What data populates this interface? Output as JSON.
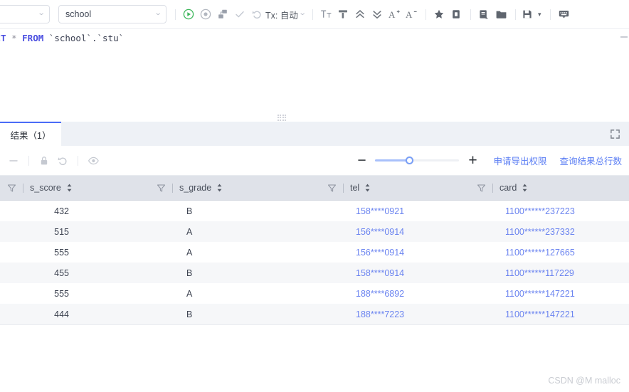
{
  "toolbar": {
    "connection_select": {
      "value": "",
      "caret": "chevron-down-icon"
    },
    "database_select": {
      "value": "school",
      "caret": "chevron-down-icon"
    },
    "run_label": "run-icon",
    "run_selection_label": "run-selection-icon",
    "explain_label": "execution-plan-icon",
    "check_label": "check-icon",
    "rollback_label": "undo-icon",
    "tx_label": "Tx: 自动",
    "format_label": "Tt",
    "beautify_label": "format-sql-icon",
    "collapse_all_label": "collapse-all-icon",
    "expand_all_label": "expand-all-icon",
    "font_increase_label": "A",
    "font_increase_sup": "+",
    "font_decrease_label": "A",
    "font_decrease_sup": "-",
    "favorite_label": "star-icon",
    "copy_label": "copy-icon",
    "snippet_label": "snippet-icon",
    "folder_label": "folder-icon",
    "save_label": "save-icon",
    "save_caret": "▾",
    "keyboard_label": "keyboard-icon"
  },
  "editor": {
    "sql_fragment_keyword1": "ECT",
    "sql_fragment_star": " * ",
    "sql_fragment_keyword2": "FROM",
    "sql_fragment_tables": " `school`.`stu`"
  },
  "results": {
    "tab_label": "结果（1）",
    "expand_icon": "fullscreen-icon",
    "toolbar": {
      "remove_row_icon": "minus-icon",
      "lock_icon": "lock-icon",
      "refresh_icon": "undo-icon",
      "view_icon": "eye-icon",
      "zoom_out": "−",
      "zoom_in": "+",
      "zoom_value": 40,
      "export_permission_link": "申请导出权限",
      "total_rows_link": "查询结果总行数"
    },
    "columns": [
      {
        "name": "s_score",
        "filter_icon": "filter-funnel-icon",
        "sort_icon": "sort-arrows-icon"
      },
      {
        "name": "s_grade",
        "filter_icon": "filter-funnel-icon",
        "sort_icon": "sort-arrows-icon"
      },
      {
        "name": "tel",
        "filter_icon": "filter-funnel-icon",
        "sort_icon": "sort-arrows-icon"
      },
      {
        "name": "card",
        "filter_icon": "filter-funnel-icon",
        "sort_icon": "sort-arrows-icon"
      }
    ],
    "rows": [
      {
        "s_score": "432",
        "s_grade": "B",
        "tel": "158****0921",
        "card": "1100******237223"
      },
      {
        "s_score": "515",
        "s_grade": "A",
        "tel": "156****0914",
        "card": "1100******237332"
      },
      {
        "s_score": "555",
        "s_grade": "A",
        "tel": "156****0914",
        "card": "1100******127665"
      },
      {
        "s_score": "455",
        "s_grade": "B",
        "tel": "158****0914",
        "card": "1100******117229"
      },
      {
        "s_score": "555",
        "s_grade": "A",
        "tel": "188****6892",
        "card": "1100******147221"
      },
      {
        "s_score": "444",
        "s_grade": "B",
        "tel": "188****7223",
        "card": "1100******147221"
      }
    ]
  },
  "watermark": {
    "text": "CSDN @M malloc"
  },
  "colors": {
    "accent": "#4a6cf7",
    "link": "#5a7df4",
    "masked_value": "#6b84f0",
    "header_bg": "#dfe2e9",
    "tabbar_bg": "#eef1f6",
    "row_alt_bg": "#f6f7f9",
    "run_green": "#3cb65a",
    "keyword": "#4a4ee0"
  }
}
